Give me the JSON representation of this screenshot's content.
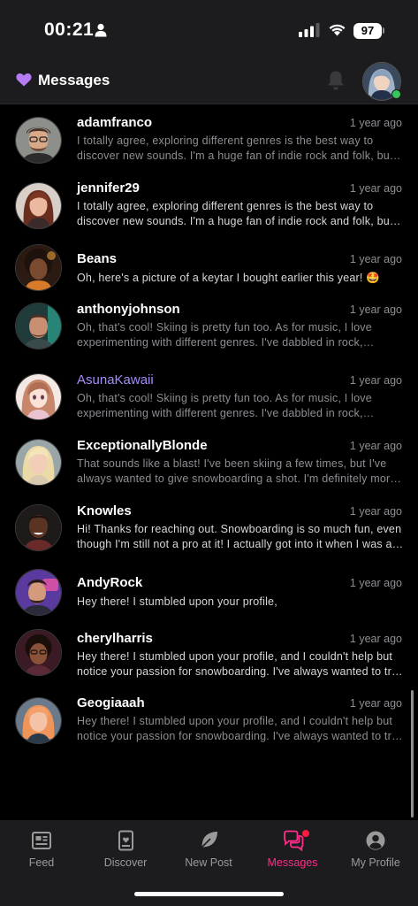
{
  "status_bar": {
    "time": "00:21",
    "battery": "97",
    "icons": [
      "person-icon",
      "signal-icon",
      "wifi-icon",
      "battery-icon"
    ]
  },
  "header": {
    "title": "Messages",
    "icons": [
      "heart-icon",
      "bell-icon",
      "profile-avatar"
    ]
  },
  "colors": {
    "accent_purple": "#a78bfa",
    "accent_pink": "#ff2d8a",
    "badge_red": "#ff1a40",
    "online_green": "#35c759"
  },
  "messages": [
    {
      "username": "adamfranco",
      "time": "1 year ago",
      "preview": "I totally agree, exploring different genres is the best way to discover new sounds. I'm a huge fan of indie rock and folk, but I also enjoy electronic music from time to time.",
      "read": true
    },
    {
      "username": "jennifer29",
      "time": "1 year ago",
      "preview": "I totally agree, exploring different genres is the best way to discover new sounds. I'm a huge fan of indie rock and folk, but I also enjoy electronic music from time to time.",
      "read": false
    },
    {
      "username": "Beans",
      "time": "1 year ago",
      "preview": "Oh, here's a picture of a keytar I bought earlier this year! 🤩",
      "read": false
    },
    {
      "username": "anthonyjohnson",
      "time": "1 year ago",
      "preview": "Oh, that's cool! Skiing is pretty fun too. As for music, I love experimenting with different genres. I've dabbled in rock, electronic and even a bit of jazz.",
      "read": true
    },
    {
      "username": "AsunaKawaii",
      "time": "1 year ago",
      "preview": "Oh, that's cool! Skiing is pretty fun too. As for music, I love experimenting with different genres. I've dabbled in rock, electronic and even a bit of jazz.",
      "read": true,
      "highlight": true
    },
    {
      "username": "ExceptionallyBlonde",
      "time": "1 year ago",
      "preview": "That sounds like a blast! I've been skiing a few times, but I've always wanted to give snowboarding a shot. I'm definitely more of a beginner though.",
      "read": true
    },
    {
      "username": "Knowles",
      "time": "1 year ago",
      "preview": "Hi! Thanks for reaching out. Snowboarding is so much fun, even though I'm still not a pro at it! I actually got into it when I was a kid.",
      "read": false
    },
    {
      "username": "AndyRock",
      "time": "1 year ago",
      "preview": "Hey there! I stumbled upon your profile,",
      "read": false
    },
    {
      "username": "cherylharris",
      "time": "1 year ago",
      "preview": "Hey there! I stumbled upon your profile, and I couldn't help but notice your passion for snowboarding. I've always wanted to try it myself.",
      "read": false
    },
    {
      "username": "Geogiaaah",
      "time": "1 year ago",
      "preview": "Hey there! I stumbled upon your profile, and I couldn't help but notice your passion for snowboarding. I've always wanted to try it myself.",
      "read": true
    }
  ],
  "tabs": [
    {
      "label": "Feed",
      "icon": "feed-icon",
      "active": false
    },
    {
      "label": "Discover",
      "icon": "discover-icon",
      "active": false
    },
    {
      "label": "New Post",
      "icon": "feather-icon",
      "active": false
    },
    {
      "label": "Messages",
      "icon": "messages-icon",
      "active": true,
      "badge": true
    },
    {
      "label": "My Profile",
      "icon": "profile-icon",
      "active": false
    }
  ]
}
